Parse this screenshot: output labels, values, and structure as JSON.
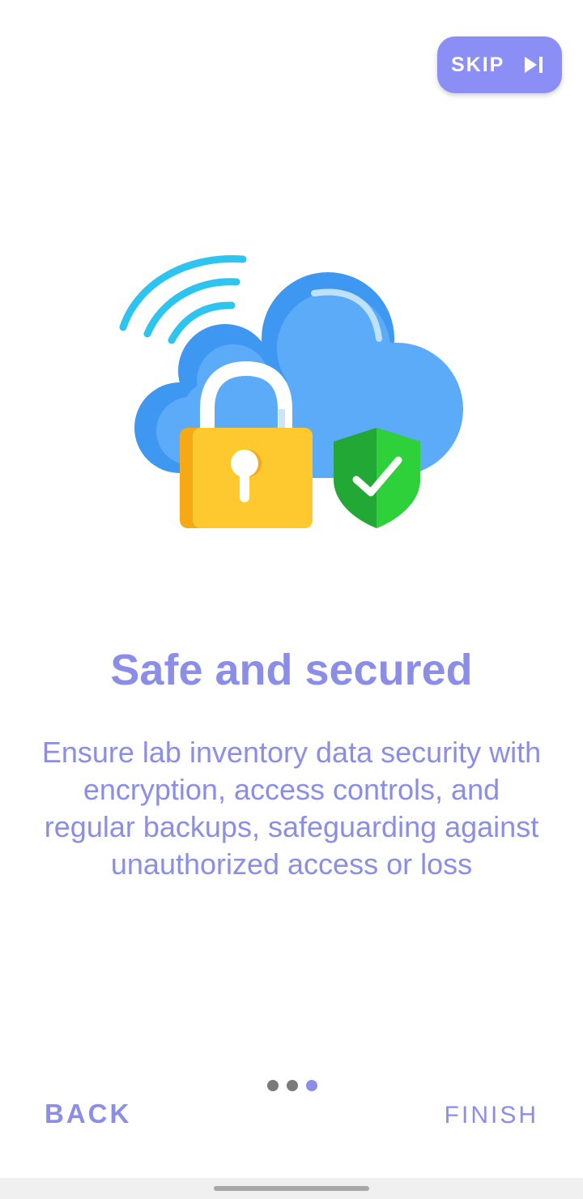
{
  "skip": {
    "label": "SKIP",
    "icon": "skip-next-icon"
  },
  "hero": {
    "icons": [
      "wifi-signal-icon",
      "cloud-icon",
      "padlock-icon",
      "shield-check-icon"
    ]
  },
  "slide": {
    "title": "Safe and secured",
    "description": "Ensure lab inventory data security with encryption, access controls, and regular backups, safeguarding against unauthorized access or loss"
  },
  "pager": {
    "total": 3,
    "current": 3
  },
  "footer": {
    "back_label": "BACK",
    "finish_label": "FINISH"
  },
  "colors": {
    "accent": "#8a8ee8",
    "skip_bg": "#8b8ff5",
    "inactive_dot": "#7a7a7a"
  }
}
